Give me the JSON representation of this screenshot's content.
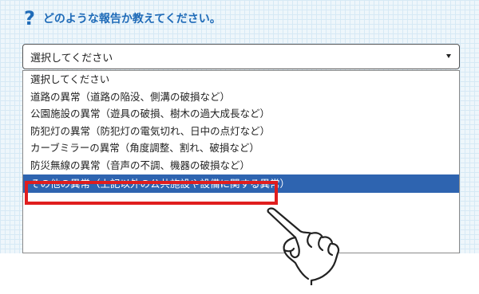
{
  "question": {
    "icon": "question-mark-icon",
    "mark": "?",
    "text": "どのような報告か教えてください。"
  },
  "select": {
    "value": "選択してください",
    "arrow_icon": "triangle-down-icon"
  },
  "options": [
    {
      "label": "選択してください"
    },
    {
      "label": "道路の異常（道路の陥没、側溝の破損など）"
    },
    {
      "label": "公園施設の異常（遊具の破損、樹木の過大成長など）"
    },
    {
      "label": "防犯灯の異常（防犯灯の電気切れ、日中の点灯など）"
    },
    {
      "label": "カーブミラーの異常（角度調整、割れ、破損など）"
    },
    {
      "label": "防災無線の異常（音声の不調、機器の破損など）"
    },
    {
      "label": "その他の異常（上記以外の公共施設や設備に関する異常）",
      "selected": true
    }
  ],
  "annotation": {
    "highlight_color": "#e01e1e",
    "pointer_icon": "hand-pointer-icon"
  },
  "colors": {
    "accent": "#1f6bb8",
    "selected_bg": "#2e64b0"
  }
}
